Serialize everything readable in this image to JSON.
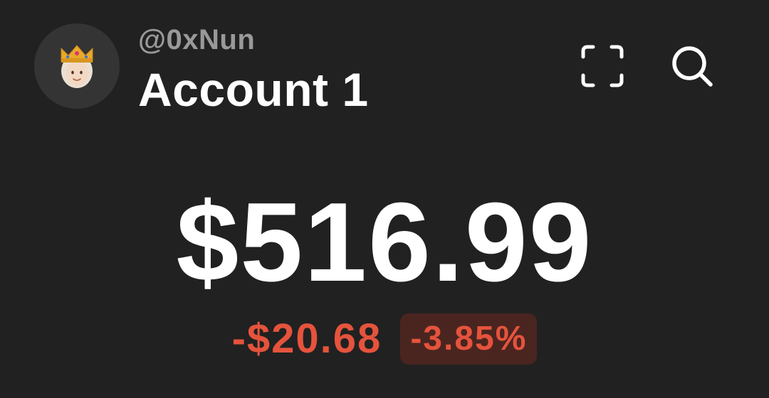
{
  "header": {
    "avatar_icon": "crowned-person-icon",
    "handle": "@0xNun",
    "account_name": "Account 1",
    "actions": [
      {
        "icon": "scan-icon"
      },
      {
        "icon": "search-icon"
      }
    ]
  },
  "balance": {
    "amount": "$516.99",
    "change_amount": "-$20.68",
    "change_percent": "-3.85%",
    "change_color": "#e5533c"
  }
}
